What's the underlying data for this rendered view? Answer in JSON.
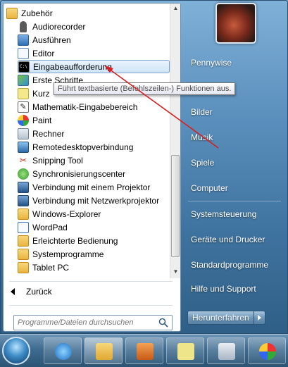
{
  "programs": [
    {
      "label": "Zubehör",
      "icon": "folder-icon",
      "indent": false
    },
    {
      "label": "Audiorecorder",
      "icon": "microphone-icon",
      "indent": true
    },
    {
      "label": "Ausführen",
      "icon": "run-icon",
      "indent": true
    },
    {
      "label": "Editor",
      "icon": "notepad-icon",
      "indent": true
    },
    {
      "label": "Eingabeaufforderung",
      "icon": "command-prompt-icon",
      "indent": true,
      "selected": true
    },
    {
      "label": "Erste Schritte",
      "icon": "getting-started-icon",
      "indent": true
    },
    {
      "label": "Kurz",
      "icon": "sticky-notes-icon",
      "indent": true
    },
    {
      "label": "Mathematik-Eingabebereich",
      "icon": "math-input-icon",
      "indent": true
    },
    {
      "label": "Paint",
      "icon": "paint-icon",
      "indent": true
    },
    {
      "label": "Rechner",
      "icon": "calculator-icon",
      "indent": true
    },
    {
      "label": "Remotedesktopverbindung",
      "icon": "remote-desktop-icon",
      "indent": true
    },
    {
      "label": "Snipping Tool",
      "icon": "scissors-icon",
      "indent": true
    },
    {
      "label": "Synchronisierungscenter",
      "icon": "sync-icon",
      "indent": true
    },
    {
      "label": "Verbindung mit einem Projektor",
      "icon": "projector-icon",
      "indent": true
    },
    {
      "label": "Verbindung mit Netzwerkprojektor",
      "icon": "network-projector-icon",
      "indent": true
    },
    {
      "label": "Windows-Explorer",
      "icon": "folder-icon",
      "indent": true
    },
    {
      "label": "WordPad",
      "icon": "wordpad-icon",
      "indent": true
    },
    {
      "label": "Erleichterte Bedienung",
      "icon": "folder-icon",
      "indent": true
    },
    {
      "label": "Systemprogramme",
      "icon": "folder-icon",
      "indent": true
    },
    {
      "label": "Tablet PC",
      "icon": "folder-icon",
      "indent": true
    }
  ],
  "back_label": "Zurück",
  "search_placeholder": "Programme/Dateien durchsuchen",
  "tooltip": "Führt textbasierte (Befehlszeilen-) Funktionen aus.",
  "right_items": [
    {
      "label": "Pennywise",
      "name": "user-folder"
    },
    {
      "label": "Bilder",
      "name": "pictures"
    },
    {
      "label": "Musik",
      "name": "music"
    },
    {
      "label": "Spiele",
      "name": "games"
    },
    {
      "label": "Computer",
      "name": "computer"
    },
    {
      "label": "Systemsteuerung",
      "name": "control-panel"
    },
    {
      "label": "Geräte und Drucker",
      "name": "devices-printers"
    },
    {
      "label": "Standardprogramme",
      "name": "default-programs"
    },
    {
      "label": "Hilfe und Support",
      "name": "help-support"
    }
  ],
  "shutdown_label": "Herunterfahren",
  "taskbar": [
    "internet-explorer-icon",
    "explorer-folder-icon",
    "media-player-icon",
    "sticky-notes-icon",
    "calculator-icon",
    "paint-icon"
  ],
  "colors": {
    "accent": "#3f739f",
    "selection": "#cfe5fa",
    "arrow": "#d82020"
  }
}
